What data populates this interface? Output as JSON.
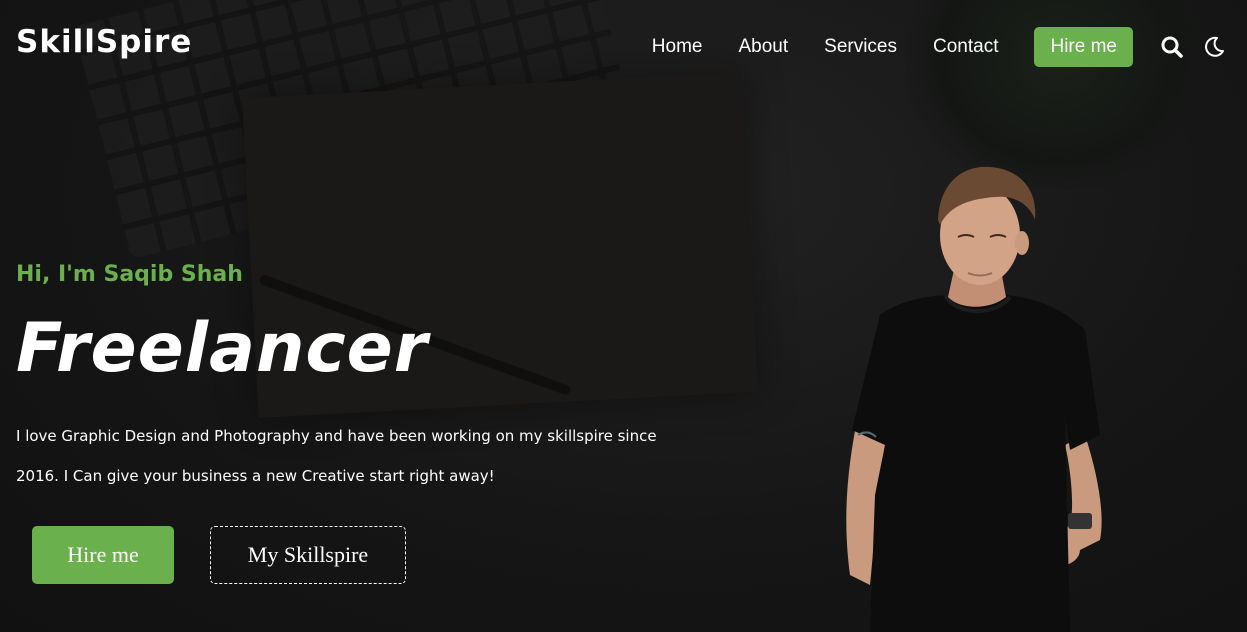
{
  "brand": {
    "logo_text": "SkillSpire"
  },
  "nav": {
    "items": [
      {
        "label": "Home"
      },
      {
        "label": "About"
      },
      {
        "label": "Services"
      },
      {
        "label": "Contact"
      }
    ],
    "cta_label": "Hire me",
    "icons": [
      "search-icon",
      "moon-icon"
    ]
  },
  "hero": {
    "greeting": "Hi, I'm Saqib Shah",
    "role": "Freelancer",
    "description_line1": "I love Graphic Design and Photography and have been working on my skillspire since",
    "description_line2": "2016. I Can give your business a new Creative start right away!",
    "primary_button": "Hire me",
    "secondary_button": "My Skillspire"
  },
  "colors": {
    "accent": "#6ab04c",
    "background": "#141414",
    "text": "#ffffff"
  }
}
